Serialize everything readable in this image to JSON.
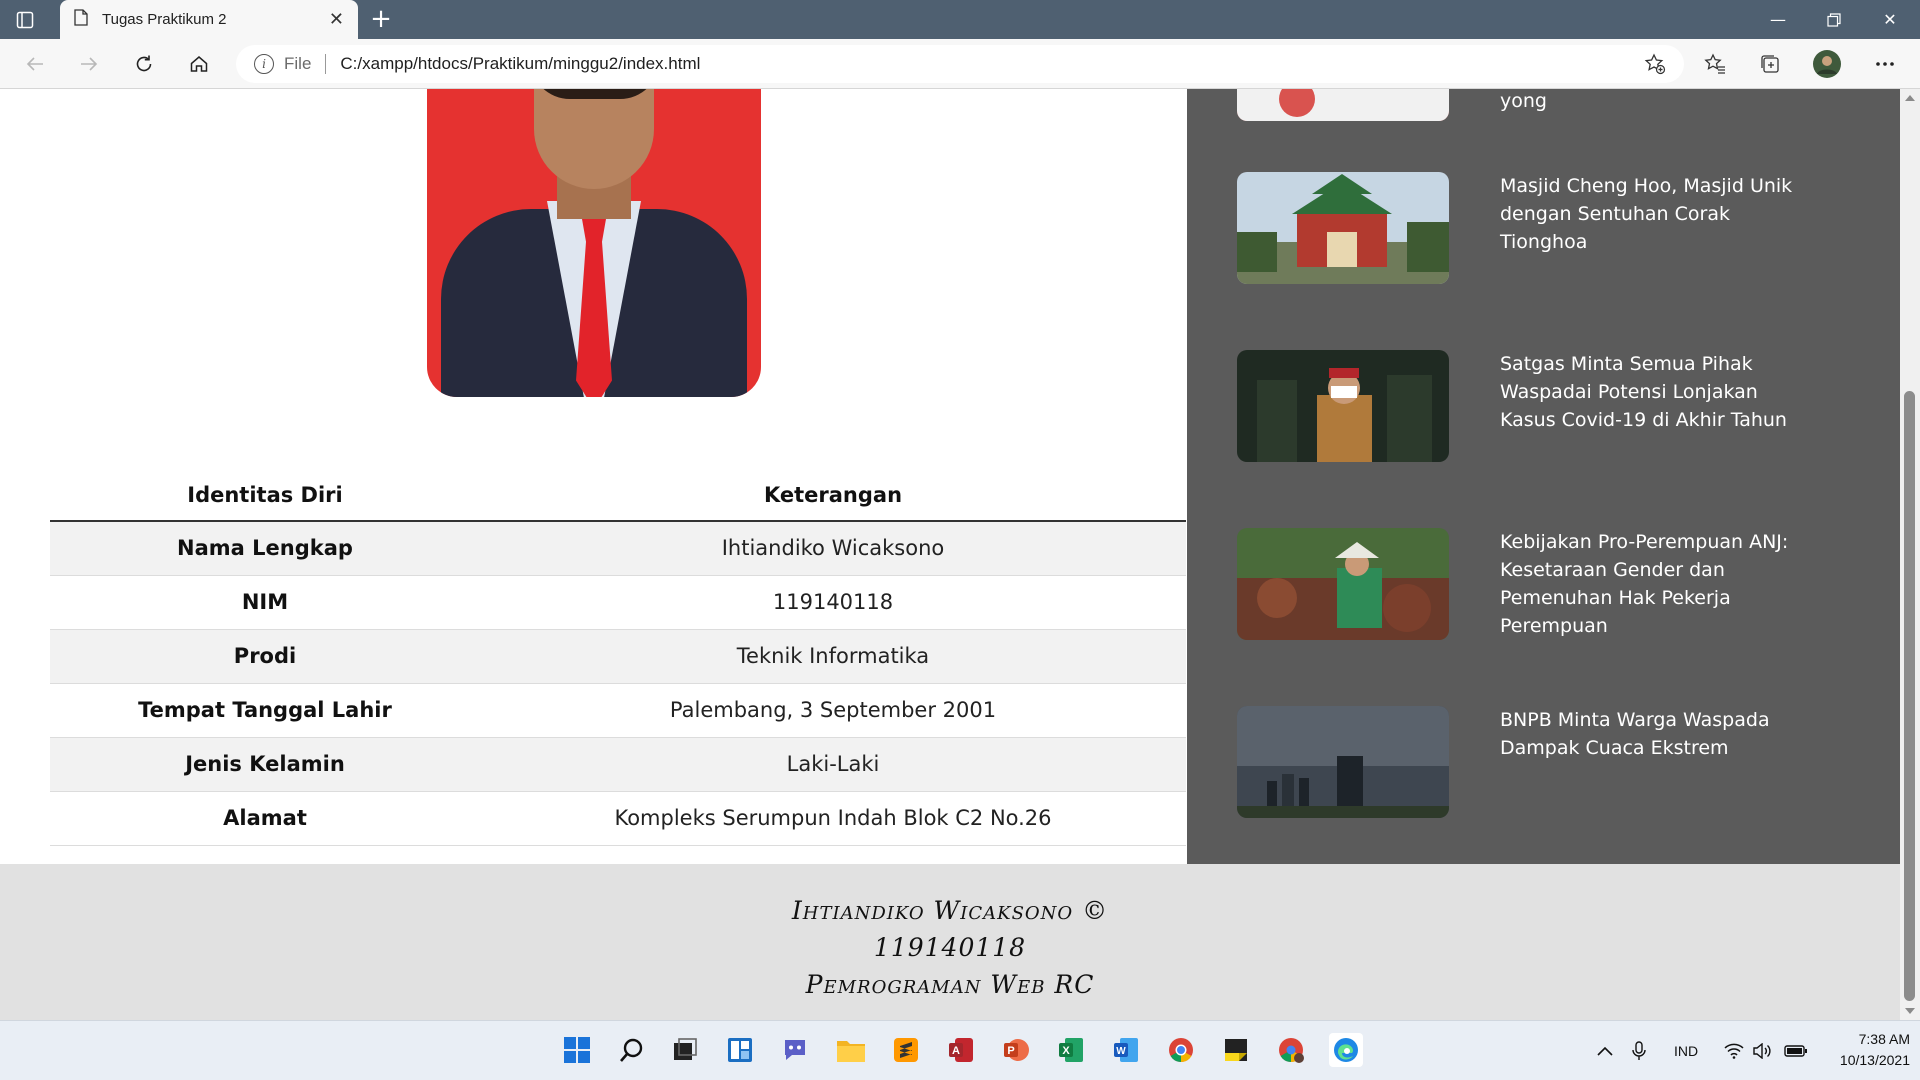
{
  "browser": {
    "tab_title": "Tugas Praktikum 2",
    "file_label": "File",
    "url": "C:/xampp/htdocs/Praktikum/minggu2/index.html"
  },
  "table": {
    "headers": [
      "Identitas Diri",
      "Keterangan"
    ],
    "rows": [
      {
        "label": "Nama Lengkap",
        "value": "Ihtiandiko Wicaksono"
      },
      {
        "label": "NIM",
        "value": "119140118"
      },
      {
        "label": "Prodi",
        "value": "Teknik Informatika"
      },
      {
        "label": "Tempat Tanggal Lahir",
        "value": "Palembang, 3 September 2001"
      },
      {
        "label": "Jenis Kelamin",
        "value": "Laki-Laki"
      },
      {
        "label": "Alamat",
        "value": "Kompleks Serumpun Indah Blok C2 No.26"
      }
    ]
  },
  "news": [
    {
      "title": "yong"
    },
    {
      "title": "Masjid Cheng Hoo, Masjid Unik dengan Sentuhan Corak Tionghoa"
    },
    {
      "title": "Satgas Minta Semua Pihak Waspadai Potensi Lonjakan Kasus Covid-19 di Akhir Tahun"
    },
    {
      "title": "Kebijakan Pro-Perempuan ANJ: Kesetaraan Gender dan Pemenuhan Hak Pekerja Perempuan"
    },
    {
      "title": "BNPB Minta Warga Waspada Dampak Cuaca Ekstrem"
    }
  ],
  "footer": {
    "line1": "Ihtiandiko Wicaksono ©",
    "line2": "119140118",
    "line3": "Pemrograman Web RC"
  },
  "taskbar": {
    "language": "IND",
    "time": "7:38 AM",
    "date": "10/13/2021"
  },
  "colors": {
    "news_panel_bg": "#5b5b5b",
    "footer_bg": "#e1e1e1",
    "tabbar_bg": "#4f6071"
  }
}
